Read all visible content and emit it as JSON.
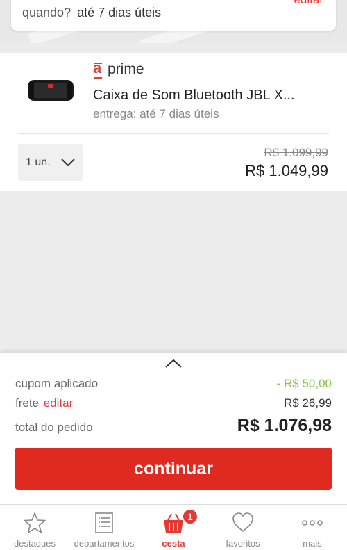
{
  "delivery": {
    "when_label": "quando?",
    "when_value": "até 7 dias úteis",
    "edit_label": "editar"
  },
  "product": {
    "image_icon": "jbl-speaker-image",
    "brand_mark": "a",
    "brand_label": "prime",
    "name": "Caixa de Som Bluetooth JBL X...",
    "shipping": "entrega: até 7 dias úteis",
    "quantity": "1 un.",
    "old_price": "R$ 1.099,99",
    "price": "R$ 1.049,99"
  },
  "summary": {
    "coupon_label": "cupom aplicado",
    "coupon_value": "- R$ 50,00",
    "shipping_label": "frete",
    "shipping_edit": "editar",
    "shipping_value": "R$ 26,99",
    "total_label": "total do pedido",
    "total_value": "R$ 1.076,98",
    "continue_label": "continuar"
  },
  "nav": {
    "items": [
      {
        "label": "destaques",
        "icon": "star-icon"
      },
      {
        "label": "departamentos",
        "icon": "list-icon"
      },
      {
        "label": "cesta",
        "icon": "basket-icon",
        "badge": "1"
      },
      {
        "label": "favoritos",
        "icon": "heart-icon"
      },
      {
        "label": "mais",
        "icon": "more-icon"
      }
    ]
  },
  "colors": {
    "accent": "#e53935",
    "button": "#e0291f",
    "discount": "#8bc34a"
  }
}
